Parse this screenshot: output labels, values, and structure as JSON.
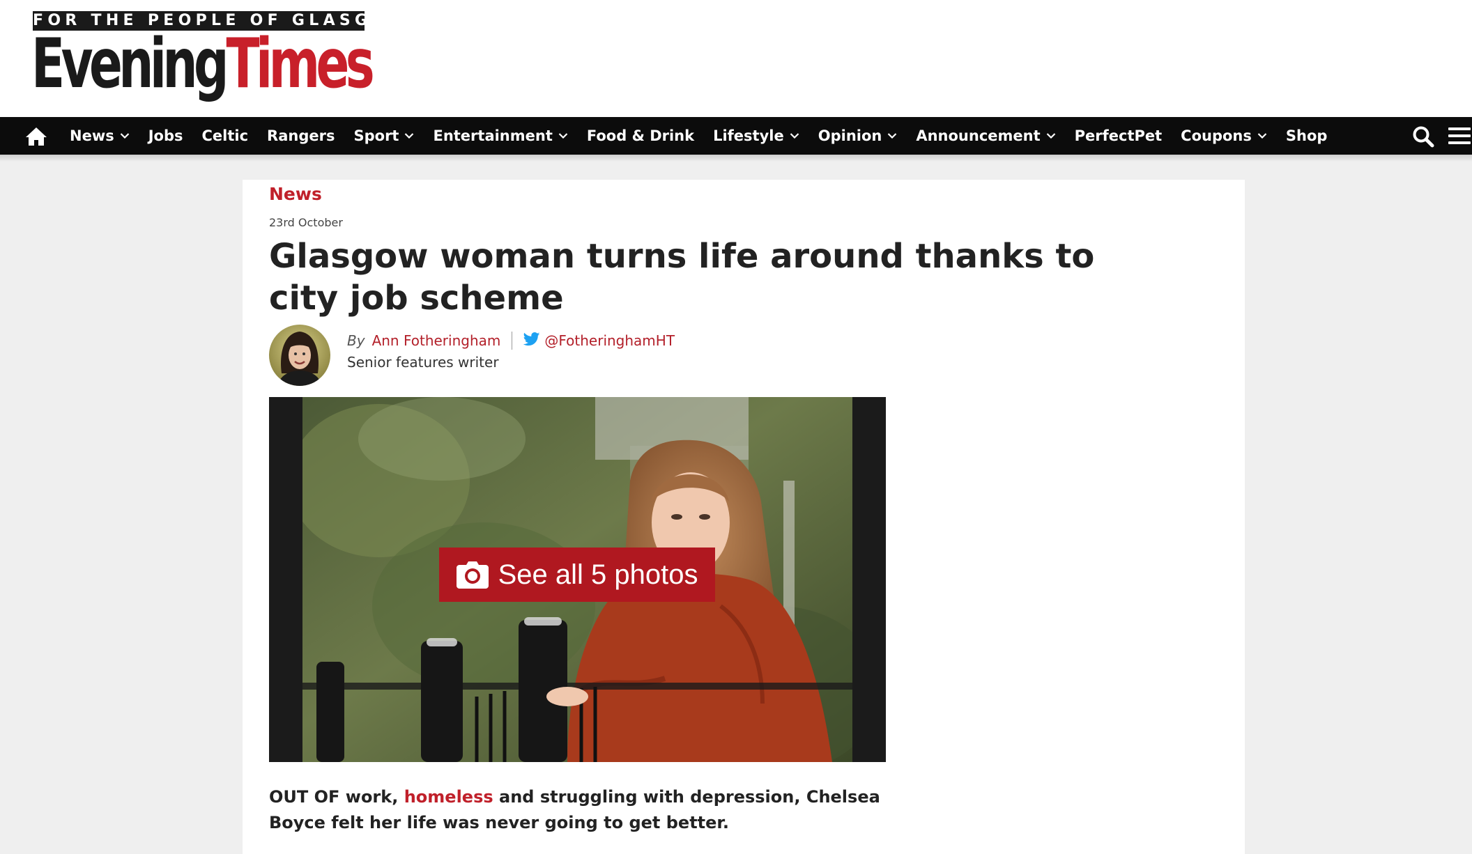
{
  "masthead": {
    "tagline": "FOR THE PEOPLE OF GLASGOW",
    "logo_word_1": "Evening",
    "logo_word_2": "Times"
  },
  "nav": {
    "home_icon": "home-icon",
    "items": [
      {
        "label": "News",
        "has_dropdown": true
      },
      {
        "label": "Jobs",
        "has_dropdown": false
      },
      {
        "label": "Celtic",
        "has_dropdown": false
      },
      {
        "label": "Rangers",
        "has_dropdown": false
      },
      {
        "label": "Sport",
        "has_dropdown": true
      },
      {
        "label": "Entertainment",
        "has_dropdown": true
      },
      {
        "label": "Food & Drink",
        "has_dropdown": false
      },
      {
        "label": "Lifestyle",
        "has_dropdown": true
      },
      {
        "label": "Opinion",
        "has_dropdown": true
      },
      {
        "label": "Announcement",
        "has_dropdown": true
      },
      {
        "label": "PerfectPet",
        "has_dropdown": false
      },
      {
        "label": "Coupons",
        "has_dropdown": true
      },
      {
        "label": "Shop",
        "has_dropdown": false
      }
    ],
    "search_icon": "search-icon",
    "menu_icon": "hamburger-menu-icon"
  },
  "article": {
    "section": "News",
    "date": "23rd October",
    "headline": "Glasgow woman turns life around thanks to city job scheme",
    "byline": {
      "by": "By",
      "author": "Ann Fotheringham",
      "twitter_handle": "@FotheringhamHT",
      "role": "Senior features writer"
    },
    "gallery_button": "See all 5 photos",
    "intro": {
      "before": "OUT OF work, ",
      "link": "homeless",
      "after": " and struggling with depression, Chelsea Boyce felt her life was never going to get better."
    }
  },
  "colors": {
    "brand_red": "#c0202a",
    "nav_background": "#0c0c0c",
    "gallery_button": "#b01820",
    "twitter_blue": "#1da1f2"
  }
}
